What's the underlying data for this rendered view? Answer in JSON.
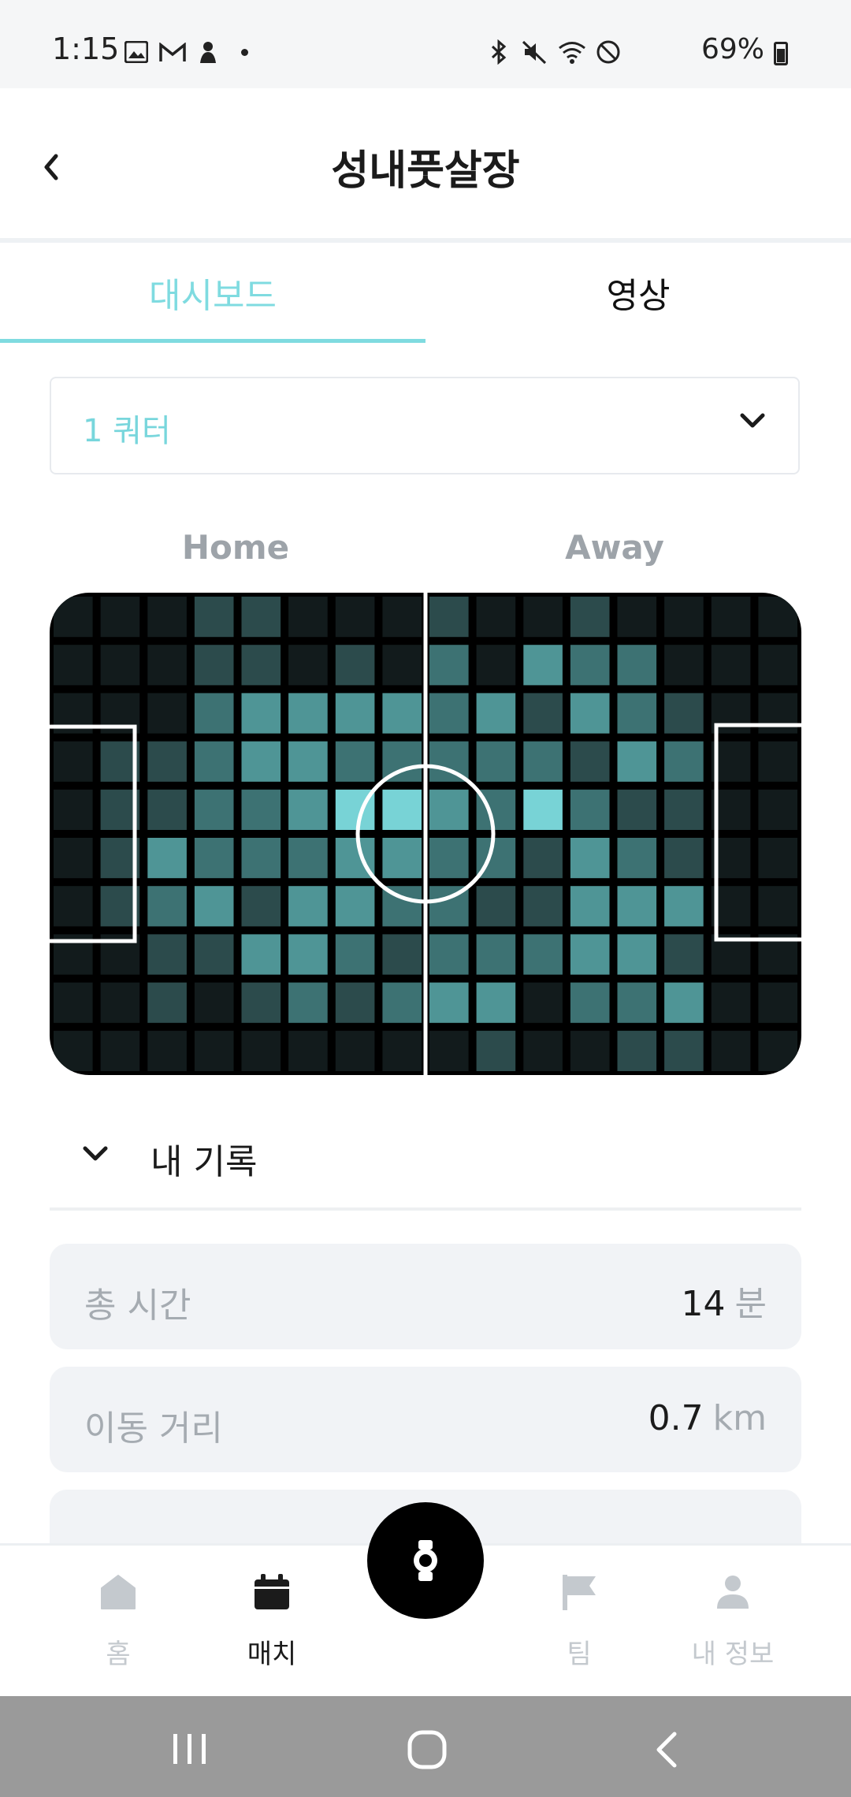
{
  "status_bar": {
    "time": "1:15",
    "battery": "69%",
    "left_icons": [
      "image-icon",
      "gmail-icon",
      "notification-icon",
      "dot-icon"
    ],
    "right_icons": [
      "bluetooth-icon",
      "mute-icon",
      "wifi-icon",
      "dnd-icon",
      "battery-icon"
    ]
  },
  "header": {
    "title": "성내풋살장",
    "back_icon": "chevron-left-icon"
  },
  "tabs": [
    {
      "label": "대시보드",
      "active": true
    },
    {
      "label": "영상",
      "active": false
    }
  ],
  "quarter_select": {
    "value": "1 쿼터",
    "icon": "chevron-down-icon"
  },
  "heatmap": {
    "home_label": "Home",
    "away_label": "Away",
    "colors": [
      "#121b1c",
      "#2c4b4c",
      "#3d7273",
      "#4f9596",
      "#78d3d6"
    ],
    "rows": [
      [
        0,
        0,
        0,
        1,
        1,
        0,
        0,
        0,
        1,
        0,
        0,
        1,
        0,
        0,
        0,
        0
      ],
      [
        0,
        0,
        0,
        1,
        1,
        0,
        1,
        0,
        2,
        0,
        3,
        2,
        2,
        0,
        0,
        0
      ],
      [
        0,
        0,
        0,
        2,
        3,
        3,
        3,
        3,
        2,
        3,
        1,
        3,
        2,
        1,
        0,
        0
      ],
      [
        0,
        1,
        1,
        2,
        3,
        3,
        2,
        2,
        2,
        2,
        2,
        1,
        3,
        2,
        0,
        0
      ],
      [
        0,
        1,
        1,
        2,
        2,
        3,
        4,
        4,
        3,
        2,
        4,
        2,
        1,
        1,
        0,
        0
      ],
      [
        0,
        1,
        3,
        2,
        2,
        2,
        3,
        3,
        2,
        2,
        1,
        3,
        2,
        1,
        0,
        0
      ],
      [
        0,
        1,
        2,
        3,
        1,
        3,
        3,
        2,
        2,
        1,
        1,
        3,
        3,
        3,
        0,
        0
      ],
      [
        0,
        0,
        1,
        1,
        3,
        3,
        2,
        1,
        2,
        2,
        2,
        3,
        3,
        1,
        0,
        0
      ],
      [
        0,
        0,
        1,
        0,
        1,
        2,
        1,
        2,
        3,
        3,
        0,
        2,
        2,
        3,
        0,
        0
      ],
      [
        0,
        0,
        0,
        0,
        0,
        0,
        0,
        0,
        0,
        1,
        0,
        0,
        1,
        1,
        0,
        0
      ]
    ]
  },
  "records": {
    "title": "내 기록",
    "stats": [
      {
        "label": "총 시간",
        "value": "14",
        "unit": "분"
      },
      {
        "label": "이동 거리",
        "value": "0.7",
        "unit": "km"
      }
    ]
  },
  "bottom_nav": {
    "items": [
      {
        "label": "홈",
        "icon": "home-icon"
      },
      {
        "label": "매치",
        "icon": "calendar-icon",
        "active": true
      },
      {
        "label": "팀",
        "icon": "flag-icon"
      },
      {
        "label": "내 정보",
        "icon": "person-icon"
      }
    ],
    "center_icon": "watch-icon"
  },
  "android_nav": [
    "recents-icon",
    "home-circle-icon",
    "back-icon"
  ]
}
